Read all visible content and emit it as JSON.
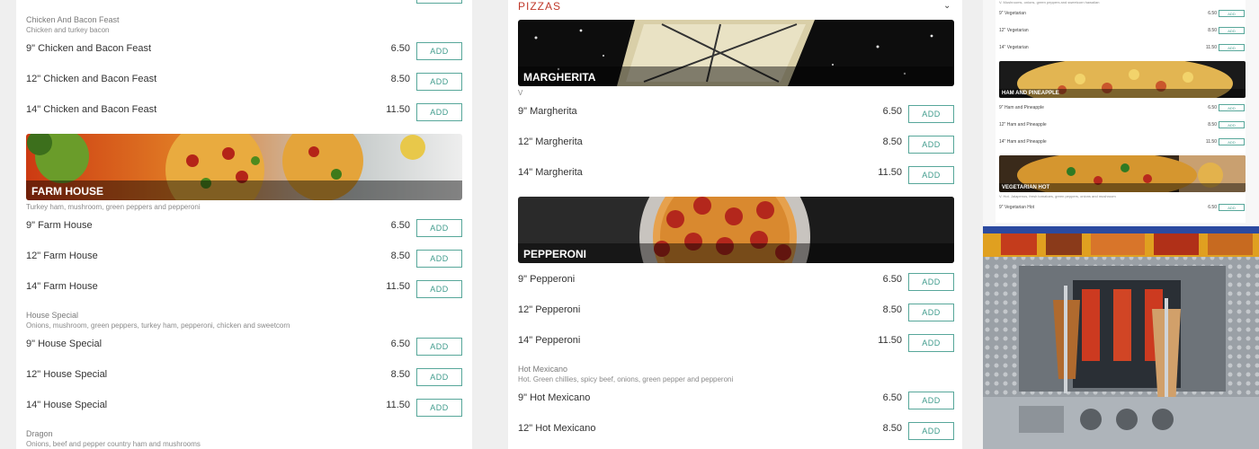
{
  "colors": {
    "accent": "#c0392b",
    "button_border": "#57a79a",
    "button_text": "#3f9b8c"
  },
  "left": {
    "sections": [
      {
        "title": "Chicken And Bacon Feast",
        "desc": "Chicken and turkey bacon"
      },
      {
        "banner": "FARM HOUSE",
        "desc": "Turkey ham, mushroom, green peppers and pepperoni"
      },
      {
        "title": "House Special",
        "desc": "Onions, mushroom, green peppers, turkey ham, pepperoni, chicken and sweetcorn"
      },
      {
        "title": "Dragon",
        "desc": "Onions, beef and pepper country ham and mushrooms"
      }
    ],
    "items": [
      {
        "name": "9\" Chicken and Bacon Feast",
        "price": "6.50"
      },
      {
        "name": "12\" Chicken and Bacon Feast",
        "price": "8.50"
      },
      {
        "name": "14\" Chicken and Bacon Feast",
        "price": "11.50"
      },
      {
        "name": "9\" Farm House",
        "price": "6.50"
      },
      {
        "name": "12\" Farm House",
        "price": "8.50"
      },
      {
        "name": "14\" Farm House",
        "price": "11.50"
      },
      {
        "name": "9\" House Special",
        "price": "6.50"
      },
      {
        "name": "12\" House Special",
        "price": "8.50"
      },
      {
        "name": "14\" House Special",
        "price": "11.50"
      }
    ]
  },
  "mid": {
    "category": "PIZZAS",
    "sections": [
      {
        "banner": "MARGHERITA",
        "desc": "V"
      },
      {
        "banner": "PEPPERONI"
      },
      {
        "title": "Hot Mexicano",
        "desc": "Hot. Green chillies, spicy beef, onions, green pepper and pepperoni"
      }
    ],
    "items": [
      {
        "name": "9\" Margherita",
        "price": "6.50"
      },
      {
        "name": "12\" Margherita",
        "price": "8.50"
      },
      {
        "name": "14\" Margherita",
        "price": "11.50"
      },
      {
        "name": "9\" Pepperoni",
        "price": "6.50"
      },
      {
        "name": "12\" Pepperoni",
        "price": "8.50"
      },
      {
        "name": "14\" Pepperoni",
        "price": "11.50"
      },
      {
        "name": "9\" Hot Mexicano",
        "price": "6.50"
      },
      {
        "name": "12\" Hot Mexicano",
        "price": "8.50"
      }
    ]
  },
  "right": {
    "top_desc": "V. Mushrooms, onions, green peppers and sweetcorn hawaiian",
    "banners": [
      "HAM AND PINEAPPLE",
      "VEGETARIAN HOT"
    ],
    "veg_hot_desc": "V. Hot. Jalapenos, fresh tomatoes, green peppers, onions and mushroom",
    "items": [
      {
        "name": "9\" Vegetarian",
        "price": "6.50"
      },
      {
        "name": "12\" Vegetarian",
        "price": "8.50"
      },
      {
        "name": "14\" Vegetarian",
        "price": "11.50"
      },
      {
        "name": "9\" Ham and Pineapple",
        "price": "6.50"
      },
      {
        "name": "12\" Ham and Pineapple",
        "price": "8.50"
      },
      {
        "name": "14\" Ham and Pineapple",
        "price": "11.50"
      },
      {
        "name": "9\" Vegetarian Hot",
        "price": "6.50"
      }
    ]
  },
  "add_label": "ADD"
}
